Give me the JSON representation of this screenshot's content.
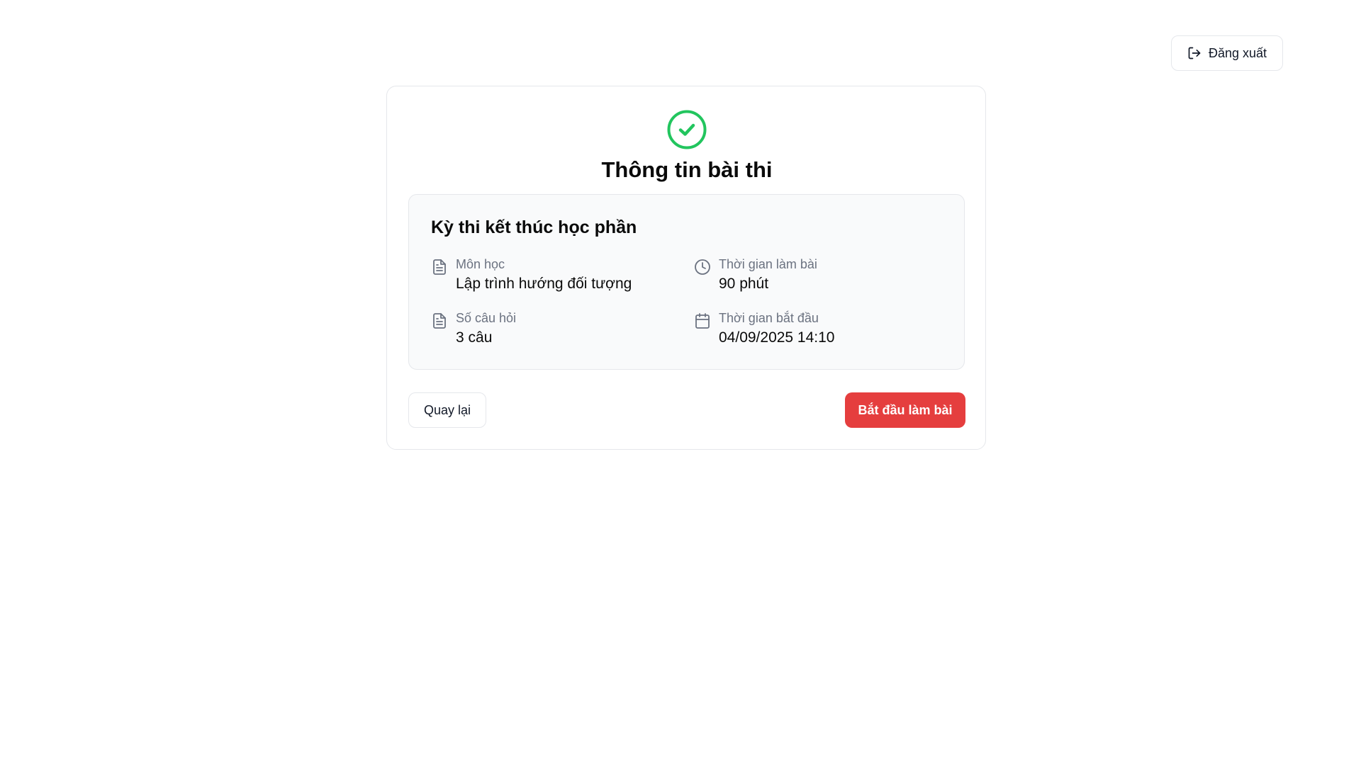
{
  "header": {
    "logout_label": "Đăng xuất",
    "logout_icon": "log-out-icon"
  },
  "card": {
    "status_icon": "check-circle-icon",
    "status_color": "#22c55e",
    "title": "Thông tin bài thi",
    "exam_name": "Kỳ thi kết thúc học phần",
    "details": {
      "subject": {
        "icon": "file-text-icon",
        "label": "Môn học",
        "value": "Lập trình hướng đối tượng"
      },
      "duration": {
        "icon": "clock-icon",
        "label": "Thời gian làm bài",
        "value": "90 phút"
      },
      "questions": {
        "icon": "file-text-icon",
        "label": "Số câu hỏi",
        "value": "3 câu"
      },
      "start_time": {
        "icon": "calendar-icon",
        "label": "Thời gian bắt đầu",
        "value": "04/09/2025 14:10"
      }
    },
    "back_label": "Quay lại",
    "start_label": "Bắt đầu làm bài",
    "start_color": "#e53e3e"
  }
}
